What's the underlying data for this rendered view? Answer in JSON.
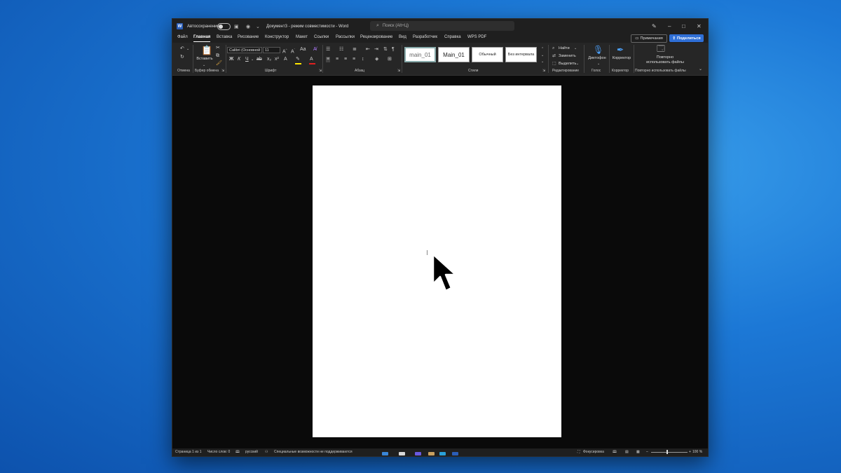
{
  "window": {
    "autosave_label": "Автосохранение",
    "doc_title": "Документ3  -  режим совместимости  -  Word",
    "search_placeholder": "Поиск (Alt+Ц)",
    "controls": {
      "minimize": "–",
      "maximize": "□",
      "close": "✕"
    }
  },
  "menu": {
    "items": [
      "Файл",
      "Главная",
      "Вставка",
      "Рисование",
      "Конструктор",
      "Макет",
      "Ссылки",
      "Рассылки",
      "Рецензирование",
      "Вид",
      "Разработчик",
      "Справка",
      "WPS PDF"
    ],
    "active": "Главная",
    "notes_label": "Примечания",
    "share_label": "Поделиться"
  },
  "ribbon": {
    "paste_label": "Вставить",
    "font_name": "Calibri (Основной",
    "font_size": "11",
    "bold": "Ж",
    "italic": "К",
    "underline": "Ч",
    "styles": [
      "main_01",
      "Main_01",
      "Обычный",
      "Без интервала"
    ],
    "find_label": "Найти",
    "replace_label": "Заменить",
    "select_label": "Выделить",
    "dictate_label": "Диктофон",
    "editor_label": "Корректор",
    "reuse_label_1": "Повторно",
    "reuse_label_2": "использовать файлы",
    "groups": [
      "Отмена",
      "Буфер обмена",
      "Шрифт",
      "Абзац",
      "Стили",
      "Редактирование",
      "Голос",
      "Корректор",
      "Повторно использовать файлы"
    ]
  },
  "status": {
    "page": "Страница 1 из 1",
    "words": "Число слов: 0",
    "language": "русский",
    "accessibility": "Специальные возможности не поддерживаются",
    "focus": "Фокусировка",
    "zoom": "100 %"
  },
  "colors": {
    "accent": "#2f6fd6",
    "highlight": "#ffe600",
    "font_color": "#e02020"
  }
}
